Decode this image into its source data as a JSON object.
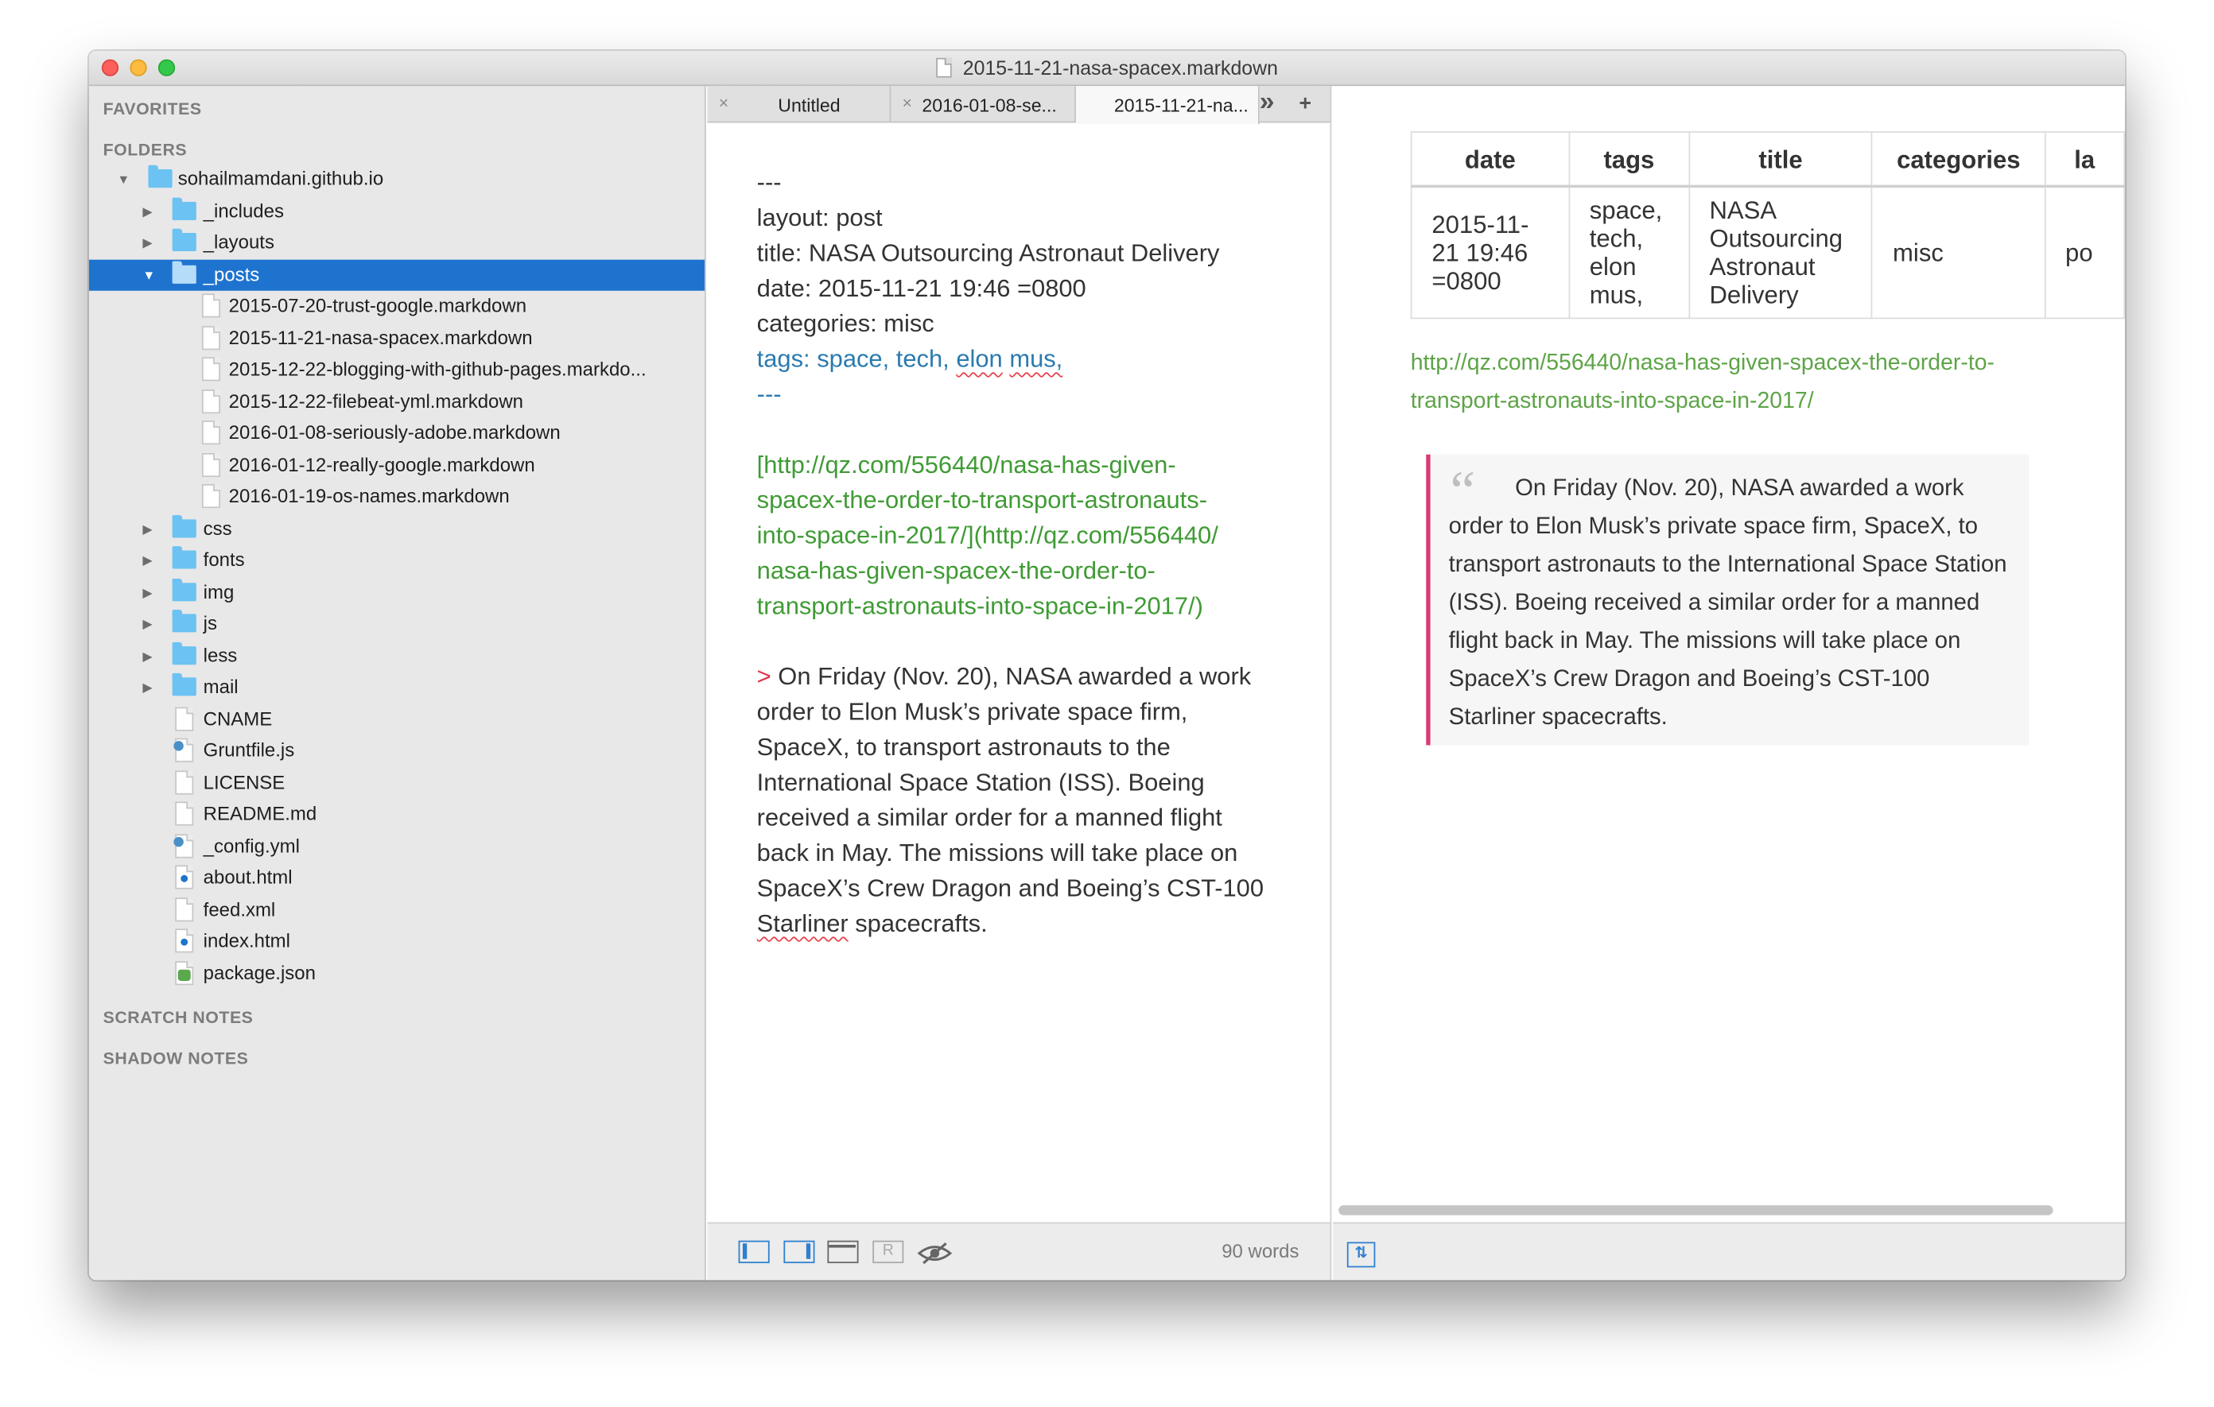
{
  "window": {
    "title": "2015-11-21-nasa-spacex.markdown"
  },
  "sidebar": {
    "sections": {
      "favorites": "FAVORITES",
      "folders": "FOLDERS",
      "scratch": "SCRATCH NOTES",
      "shadow": "SHADOW NOTES"
    },
    "root": "sohailmamdani.github.io",
    "items": {
      "includes": "_includes",
      "layouts": "_layouts",
      "posts": "_posts",
      "post1": "2015-07-20-trust-google.markdown",
      "post2": "2015-11-21-nasa-spacex.markdown",
      "post3": "2015-12-22-blogging-with-github-pages.markdo...",
      "post4": "2015-12-22-filebeat-yml.markdown",
      "post5": "2016-01-08-seriously-adobe.markdown",
      "post6": "2016-01-12-really-google.markdown",
      "post7": "2016-01-19-os-names.markdown",
      "css": "css",
      "fonts": "fonts",
      "img": "img",
      "js": "js",
      "less": "less",
      "mail": "mail",
      "cname": "CNAME",
      "gruntfile": "Gruntfile.js",
      "license": "LICENSE",
      "readme": "README.md",
      "config": "_config.yml",
      "about": "about.html",
      "feed": "feed.xml",
      "index": "index.html",
      "package": "package.json"
    }
  },
  "tabs": {
    "tab1": "Untitled",
    "tab2": "2016-01-08-se...",
    "tab3": "2015-11-21-na...",
    "overflow": "»",
    "add": "+",
    "close": "×"
  },
  "editor": {
    "fm_open": "---",
    "layout": "layout: post",
    "title": "title: NASA Outsourcing Astronaut Delivery",
    "date": "date: 2015-11-21 19:46 =0800",
    "categories": "categories: misc",
    "tags_key": "tags:",
    "tag1": "space,",
    "tag2": "tech,",
    "tag3": "elon",
    "tag4": "mus,",
    "fm_close": "---",
    "link1": "[http://qz.com/556440/nasa-has-given-",
    "link2": "spacex-the-order-to-transport-astronauts-",
    "link3": "into-space-in-2017/](http://qz.com/556440/",
    "link4": "nasa-has-given-spacex-the-order-to-",
    "link5": "transport-astronauts-into-space-in-2017/)",
    "quote_marker": ">",
    "q1": "On Friday (Nov. 20), NASA awarded a work",
    "q2": "order to Elon Musk’s private space firm,",
    "q3": "SpaceX, to transport astronauts to the",
    "q4": "International Space Station (ISS). Boeing",
    "q5": "received a similar order for a manned flight",
    "q6": "back in May. The missions will take place on",
    "q7": "SpaceX’s Crew Dragon and Boeing’s CST-100",
    "q8a": "Starliner",
    "q8b": " spacecrafts.",
    "word_count": "90 words",
    "r_icon": "R"
  },
  "preview": {
    "table": {
      "headers": [
        "date",
        "tags",
        "title",
        "categories",
        "la"
      ],
      "row": [
        "2015-11-21 19:46 =0800",
        "space, tech, elon mus,",
        "NASA Outsourcing Astronaut Delivery",
        "misc",
        "po"
      ]
    },
    "link": "http://qz.com/556440/nasa-has-given-spacex-the-order-to-transport-astronauts-into-space-in-2017/",
    "quote": "On Friday (Nov. 20), NASA awarded a work order to Elon Musk’s private space firm, SpaceX, to transport astronauts to the International Space Station (ISS). Boeing received a similar order for a manned flight back in May. The missions will take place on SpaceX’s Crew Dragon and Boeing’s CST-100 Starliner spacecrafts.",
    "quote_mark": "“",
    "sync_icon": "⇅"
  },
  "colors": {
    "selection": "#1e73cf",
    "folder": "#6cc2f2",
    "link_green": "#3f9b34",
    "tag_blue": "#2a7ab0",
    "quote_bar": "#d73a7a"
  },
  "icons": [
    "close-icon",
    "chevron-right-icon",
    "folder-icon",
    "file-icon",
    "layout-left-icon",
    "layout-right-icon",
    "window-icon",
    "r-icon",
    "eye-icon",
    "sync-scroll-icon"
  ]
}
